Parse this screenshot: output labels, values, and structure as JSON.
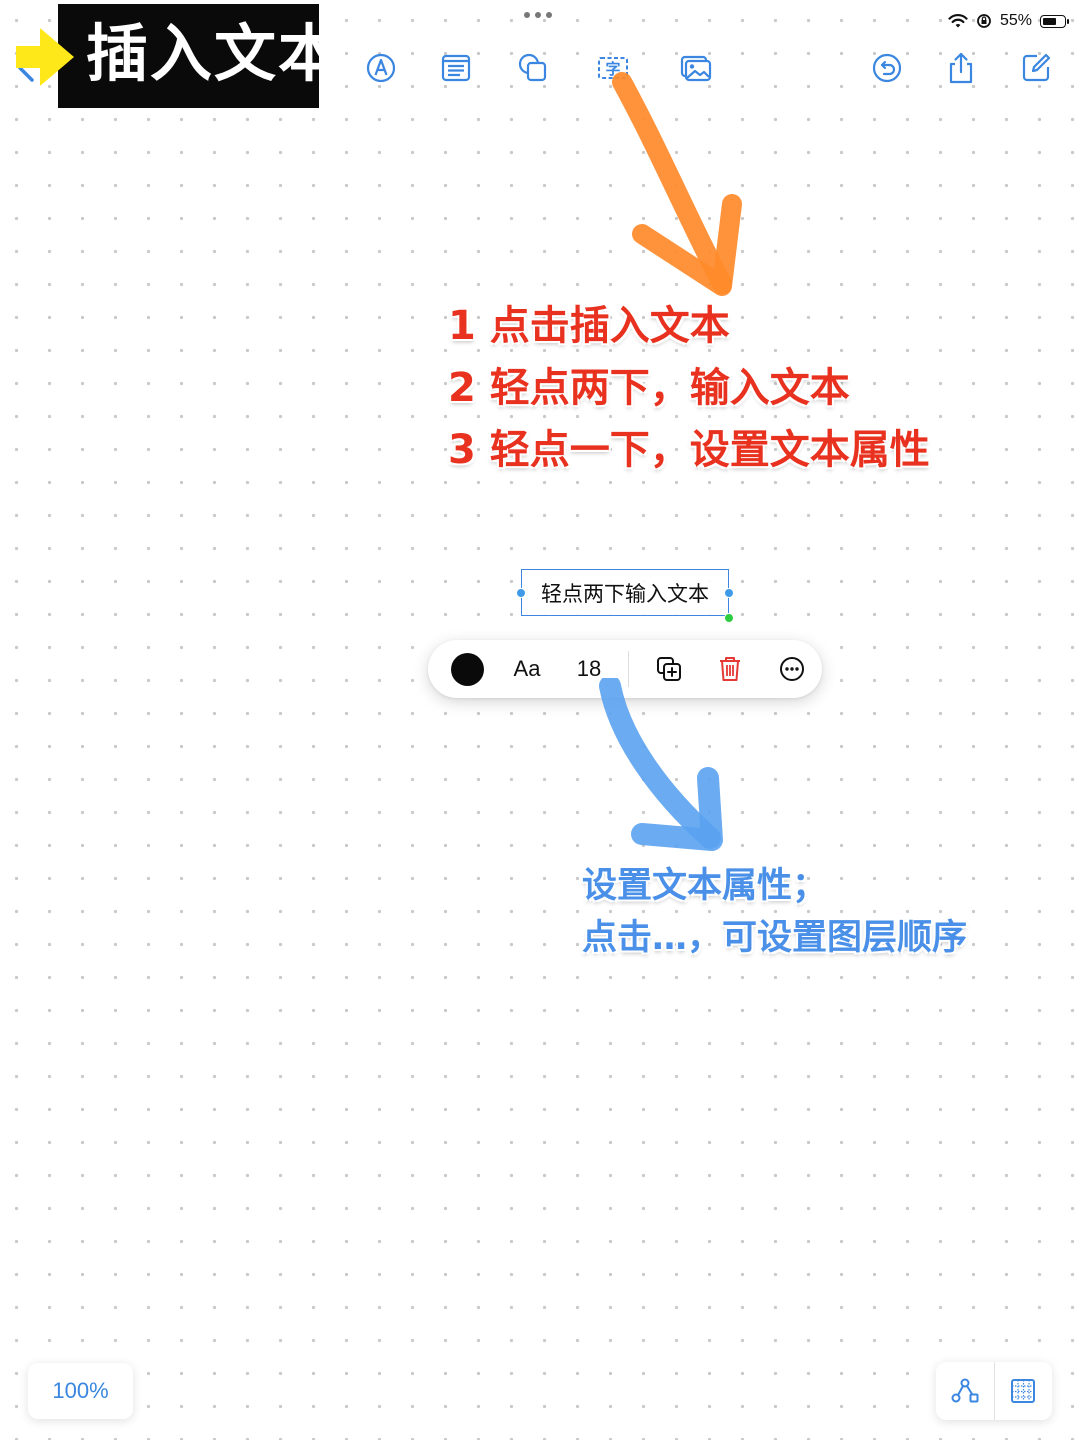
{
  "status_bar": {
    "battery": "55%"
  },
  "banner": {
    "title": "插入文本"
  },
  "instructions": {
    "steps": [
      "1 点击插入文本",
      "2 轻点两下，输入文本",
      "3 轻点一下，设置文本属性"
    ],
    "note_lines": [
      "设置文本属性；",
      "点击…，可设置图层顺序"
    ]
  },
  "canvas": {
    "text_box": "轻点两下输入文本"
  },
  "format_bar": {
    "font_label": "Aa",
    "font_size": "18"
  },
  "zoom": {
    "level": "100%"
  },
  "colors": {
    "accent": "#3A86E0",
    "instruction_red": "#E8321F",
    "note_blue": "#4A90E8",
    "arrow_orange": "#FF8A2A",
    "delete_red": "#E53935"
  }
}
